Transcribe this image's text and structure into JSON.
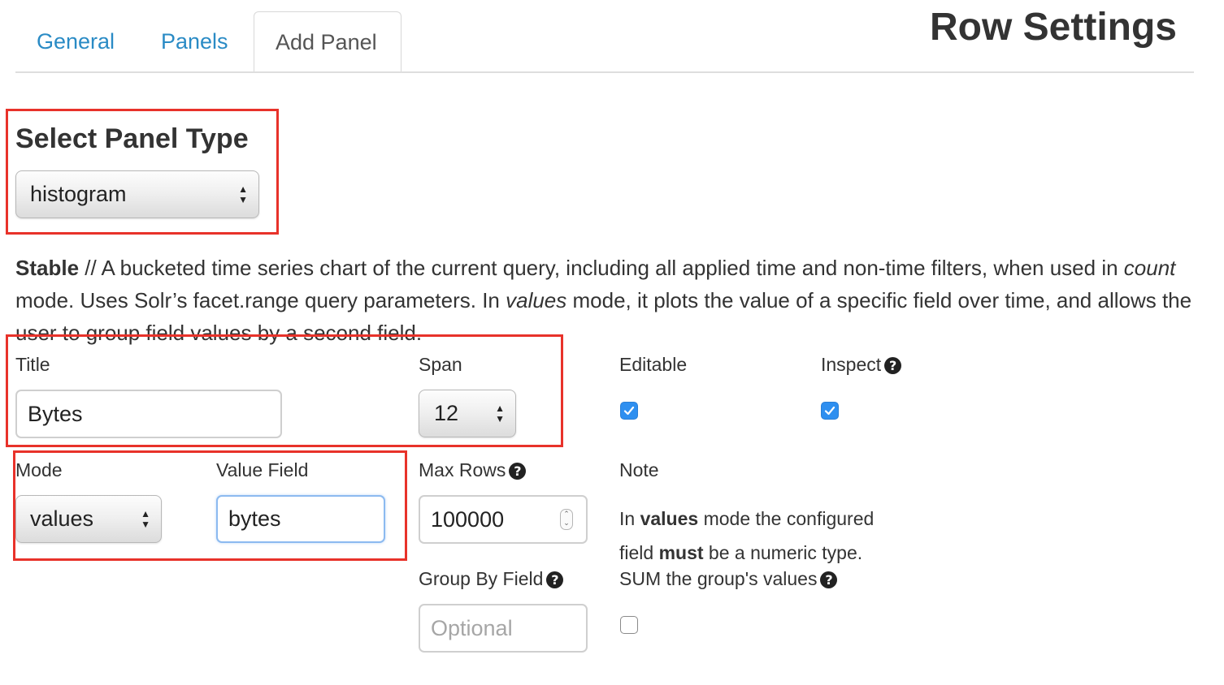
{
  "tabs": [
    {
      "label": "General",
      "active": false
    },
    {
      "label": "Panels",
      "active": false
    },
    {
      "label": "Add Panel",
      "active": true
    }
  ],
  "modal_title": "Row Settings",
  "panel_type": {
    "heading": "Select Panel Type",
    "selected": "histogram"
  },
  "description": {
    "stability": "Stable",
    "part1": " // A bucketed time series chart of the current query, including all applied time and non-time filters, when used in ",
    "em1": "count",
    "part2": " mode. Uses Solr’s facet.range query parameters. In ",
    "em2": "values",
    "part3": " mode, it plots the value of a specific field over time, and allows the user to group field values by a second field."
  },
  "fields": {
    "title": {
      "label": "Title",
      "value": "Bytes"
    },
    "span": {
      "label": "Span",
      "value": "12"
    },
    "editable": {
      "label": "Editable",
      "checked": true
    },
    "inspect": {
      "label": "Inspect",
      "checked": true
    },
    "mode": {
      "label": "Mode",
      "value": "values"
    },
    "value_field": {
      "label": "Value Field",
      "value": "bytes"
    },
    "max_rows": {
      "label": "Max Rows",
      "value": "100000"
    },
    "group_by": {
      "label": "Group By Field",
      "placeholder": "Optional"
    },
    "sum_group": {
      "label": "SUM the group's values",
      "checked": false
    }
  },
  "note": {
    "label": "Note",
    "line1_pre": "In ",
    "line1_bold": "values",
    "line1_post": " mode the configured",
    "line2_pre": "field ",
    "line2_bold": "must",
    "line2_post": " be a numeric type."
  },
  "icons": {
    "help": "question-circle-icon",
    "check": "check-icon",
    "select_arrows": "updown-arrows-icon"
  },
  "colors": {
    "tab_link": "#2a8bc5",
    "highlight": "#e8322a",
    "checkbox": "#2e8ff0",
    "focus": "#8cbaf0"
  }
}
